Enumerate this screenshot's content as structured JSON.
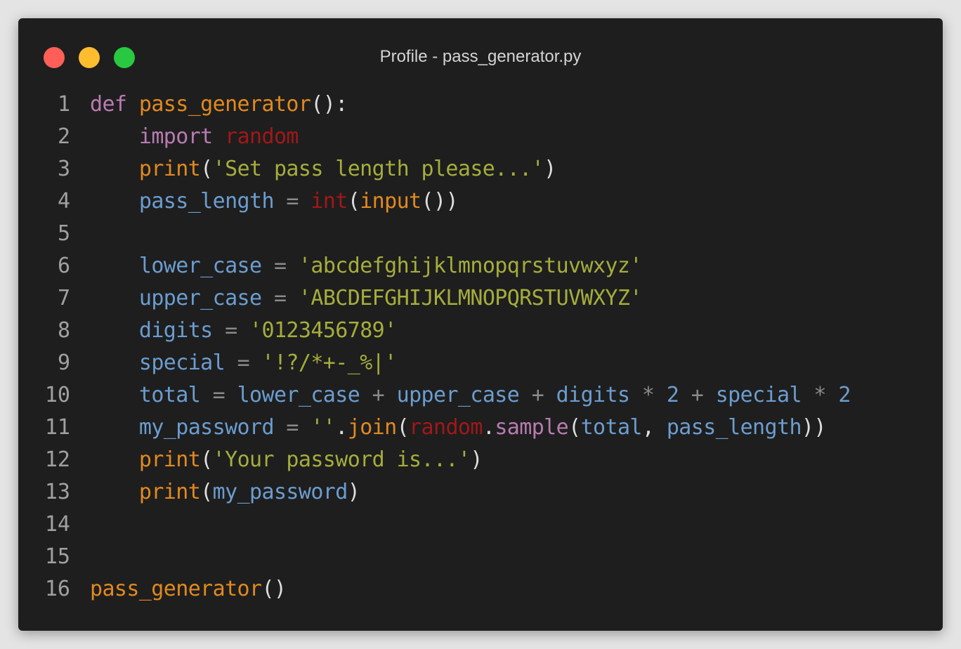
{
  "window": {
    "title": "Profile - pass_generator.py",
    "buttons": [
      {
        "name": "close",
        "color": "#ff5f57"
      },
      {
        "name": "minimize",
        "color": "#febc2e"
      },
      {
        "name": "maximize",
        "color": "#28c840"
      }
    ]
  },
  "colors": {
    "background": "#1e1e1e",
    "keyword": "#b97bb2",
    "function": "#e2891f",
    "builtin_module": "#a01818",
    "string": "#a5ad3c",
    "variable": "#6b9dd0",
    "operator": "#8a8a8a",
    "line_number": "#a0a0a0"
  },
  "editor": {
    "line_numbers": [
      "1",
      "2",
      "3",
      "4",
      "5",
      "6",
      "7",
      "8",
      "9",
      "10",
      "11",
      "12",
      "13",
      "14",
      "15",
      "16"
    ],
    "lines": [
      [
        [
          "t-kw",
          "def"
        ],
        [
          "t-ws",
          " "
        ],
        [
          "t-fn",
          "pass_generator"
        ],
        [
          "t-paren",
          "():"
        ]
      ],
      [
        [
          "t-ws",
          "    "
        ],
        [
          "t-kw",
          "import"
        ],
        [
          "t-ws",
          " "
        ],
        [
          "t-mod",
          "random"
        ]
      ],
      [
        [
          "t-ws",
          "    "
        ],
        [
          "t-fn",
          "print"
        ],
        [
          "t-paren",
          "("
        ],
        [
          "t-str",
          "'Set pass length please...'"
        ],
        [
          "t-paren",
          ")"
        ]
      ],
      [
        [
          "t-ws",
          "    "
        ],
        [
          "t-var",
          "pass_length"
        ],
        [
          "t-ws",
          " "
        ],
        [
          "t-op",
          "="
        ],
        [
          "t-ws",
          " "
        ],
        [
          "t-mod",
          "int"
        ],
        [
          "t-paren",
          "("
        ],
        [
          "t-fn",
          "input"
        ],
        [
          "t-paren",
          "())"
        ]
      ],
      [],
      [
        [
          "t-ws",
          "    "
        ],
        [
          "t-var",
          "lower_case"
        ],
        [
          "t-ws",
          " "
        ],
        [
          "t-op",
          "="
        ],
        [
          "t-ws",
          " "
        ],
        [
          "t-str",
          "'abcdefghijklmnopqrstuvwxyz'"
        ]
      ],
      [
        [
          "t-ws",
          "    "
        ],
        [
          "t-var",
          "upper_case"
        ],
        [
          "t-ws",
          " "
        ],
        [
          "t-op",
          "="
        ],
        [
          "t-ws",
          " "
        ],
        [
          "t-str",
          "'ABCDEFGHIJKLMNOPQRSTUVWXYZ'"
        ]
      ],
      [
        [
          "t-ws",
          "    "
        ],
        [
          "t-var",
          "digits"
        ],
        [
          "t-ws",
          " "
        ],
        [
          "t-op",
          "="
        ],
        [
          "t-ws",
          " "
        ],
        [
          "t-str",
          "'0123456789'"
        ]
      ],
      [
        [
          "t-ws",
          "    "
        ],
        [
          "t-var",
          "special"
        ],
        [
          "t-ws",
          " "
        ],
        [
          "t-op",
          "="
        ],
        [
          "t-ws",
          " "
        ],
        [
          "t-str",
          "'!?/*+-_%|'"
        ]
      ],
      [
        [
          "t-ws",
          "    "
        ],
        [
          "t-var",
          "total"
        ],
        [
          "t-ws",
          " "
        ],
        [
          "t-op",
          "="
        ],
        [
          "t-ws",
          " "
        ],
        [
          "t-var",
          "lower_case"
        ],
        [
          "t-ws",
          " "
        ],
        [
          "t-op",
          "+"
        ],
        [
          "t-ws",
          " "
        ],
        [
          "t-var",
          "upper_case"
        ],
        [
          "t-ws",
          " "
        ],
        [
          "t-op",
          "+"
        ],
        [
          "t-ws",
          " "
        ],
        [
          "t-var",
          "digits"
        ],
        [
          "t-ws",
          " "
        ],
        [
          "t-op",
          "*"
        ],
        [
          "t-ws",
          " "
        ],
        [
          "t-num",
          "2"
        ],
        [
          "t-ws",
          " "
        ],
        [
          "t-op",
          "+"
        ],
        [
          "t-ws",
          " "
        ],
        [
          "t-var",
          "special"
        ],
        [
          "t-ws",
          " "
        ],
        [
          "t-op",
          "*"
        ],
        [
          "t-ws",
          " "
        ],
        [
          "t-num",
          "2"
        ]
      ],
      [
        [
          "t-ws",
          "    "
        ],
        [
          "t-var",
          "my_password"
        ],
        [
          "t-ws",
          " "
        ],
        [
          "t-op",
          "="
        ],
        [
          "t-ws",
          " "
        ],
        [
          "t-str",
          "''"
        ],
        [
          "t-punct",
          "."
        ],
        [
          "t-fn",
          "join"
        ],
        [
          "t-paren",
          "("
        ],
        [
          "t-mod",
          "random"
        ],
        [
          "t-punct",
          "."
        ],
        [
          "t-meth",
          "sample"
        ],
        [
          "t-paren",
          "("
        ],
        [
          "t-var",
          "total"
        ],
        [
          "t-punct",
          ", "
        ],
        [
          "t-var",
          "pass_length"
        ],
        [
          "t-paren",
          "))"
        ]
      ],
      [
        [
          "t-ws",
          "    "
        ],
        [
          "t-fn",
          "print"
        ],
        [
          "t-paren",
          "("
        ],
        [
          "t-str",
          "'Your password is...'"
        ],
        [
          "t-paren",
          ")"
        ]
      ],
      [
        [
          "t-ws",
          "    "
        ],
        [
          "t-fn",
          "print"
        ],
        [
          "t-paren",
          "("
        ],
        [
          "t-var",
          "my_password"
        ],
        [
          "t-paren",
          ")"
        ]
      ],
      [],
      [],
      [
        [
          "t-fn",
          "pass_generator"
        ],
        [
          "t-paren",
          "()"
        ]
      ]
    ]
  }
}
